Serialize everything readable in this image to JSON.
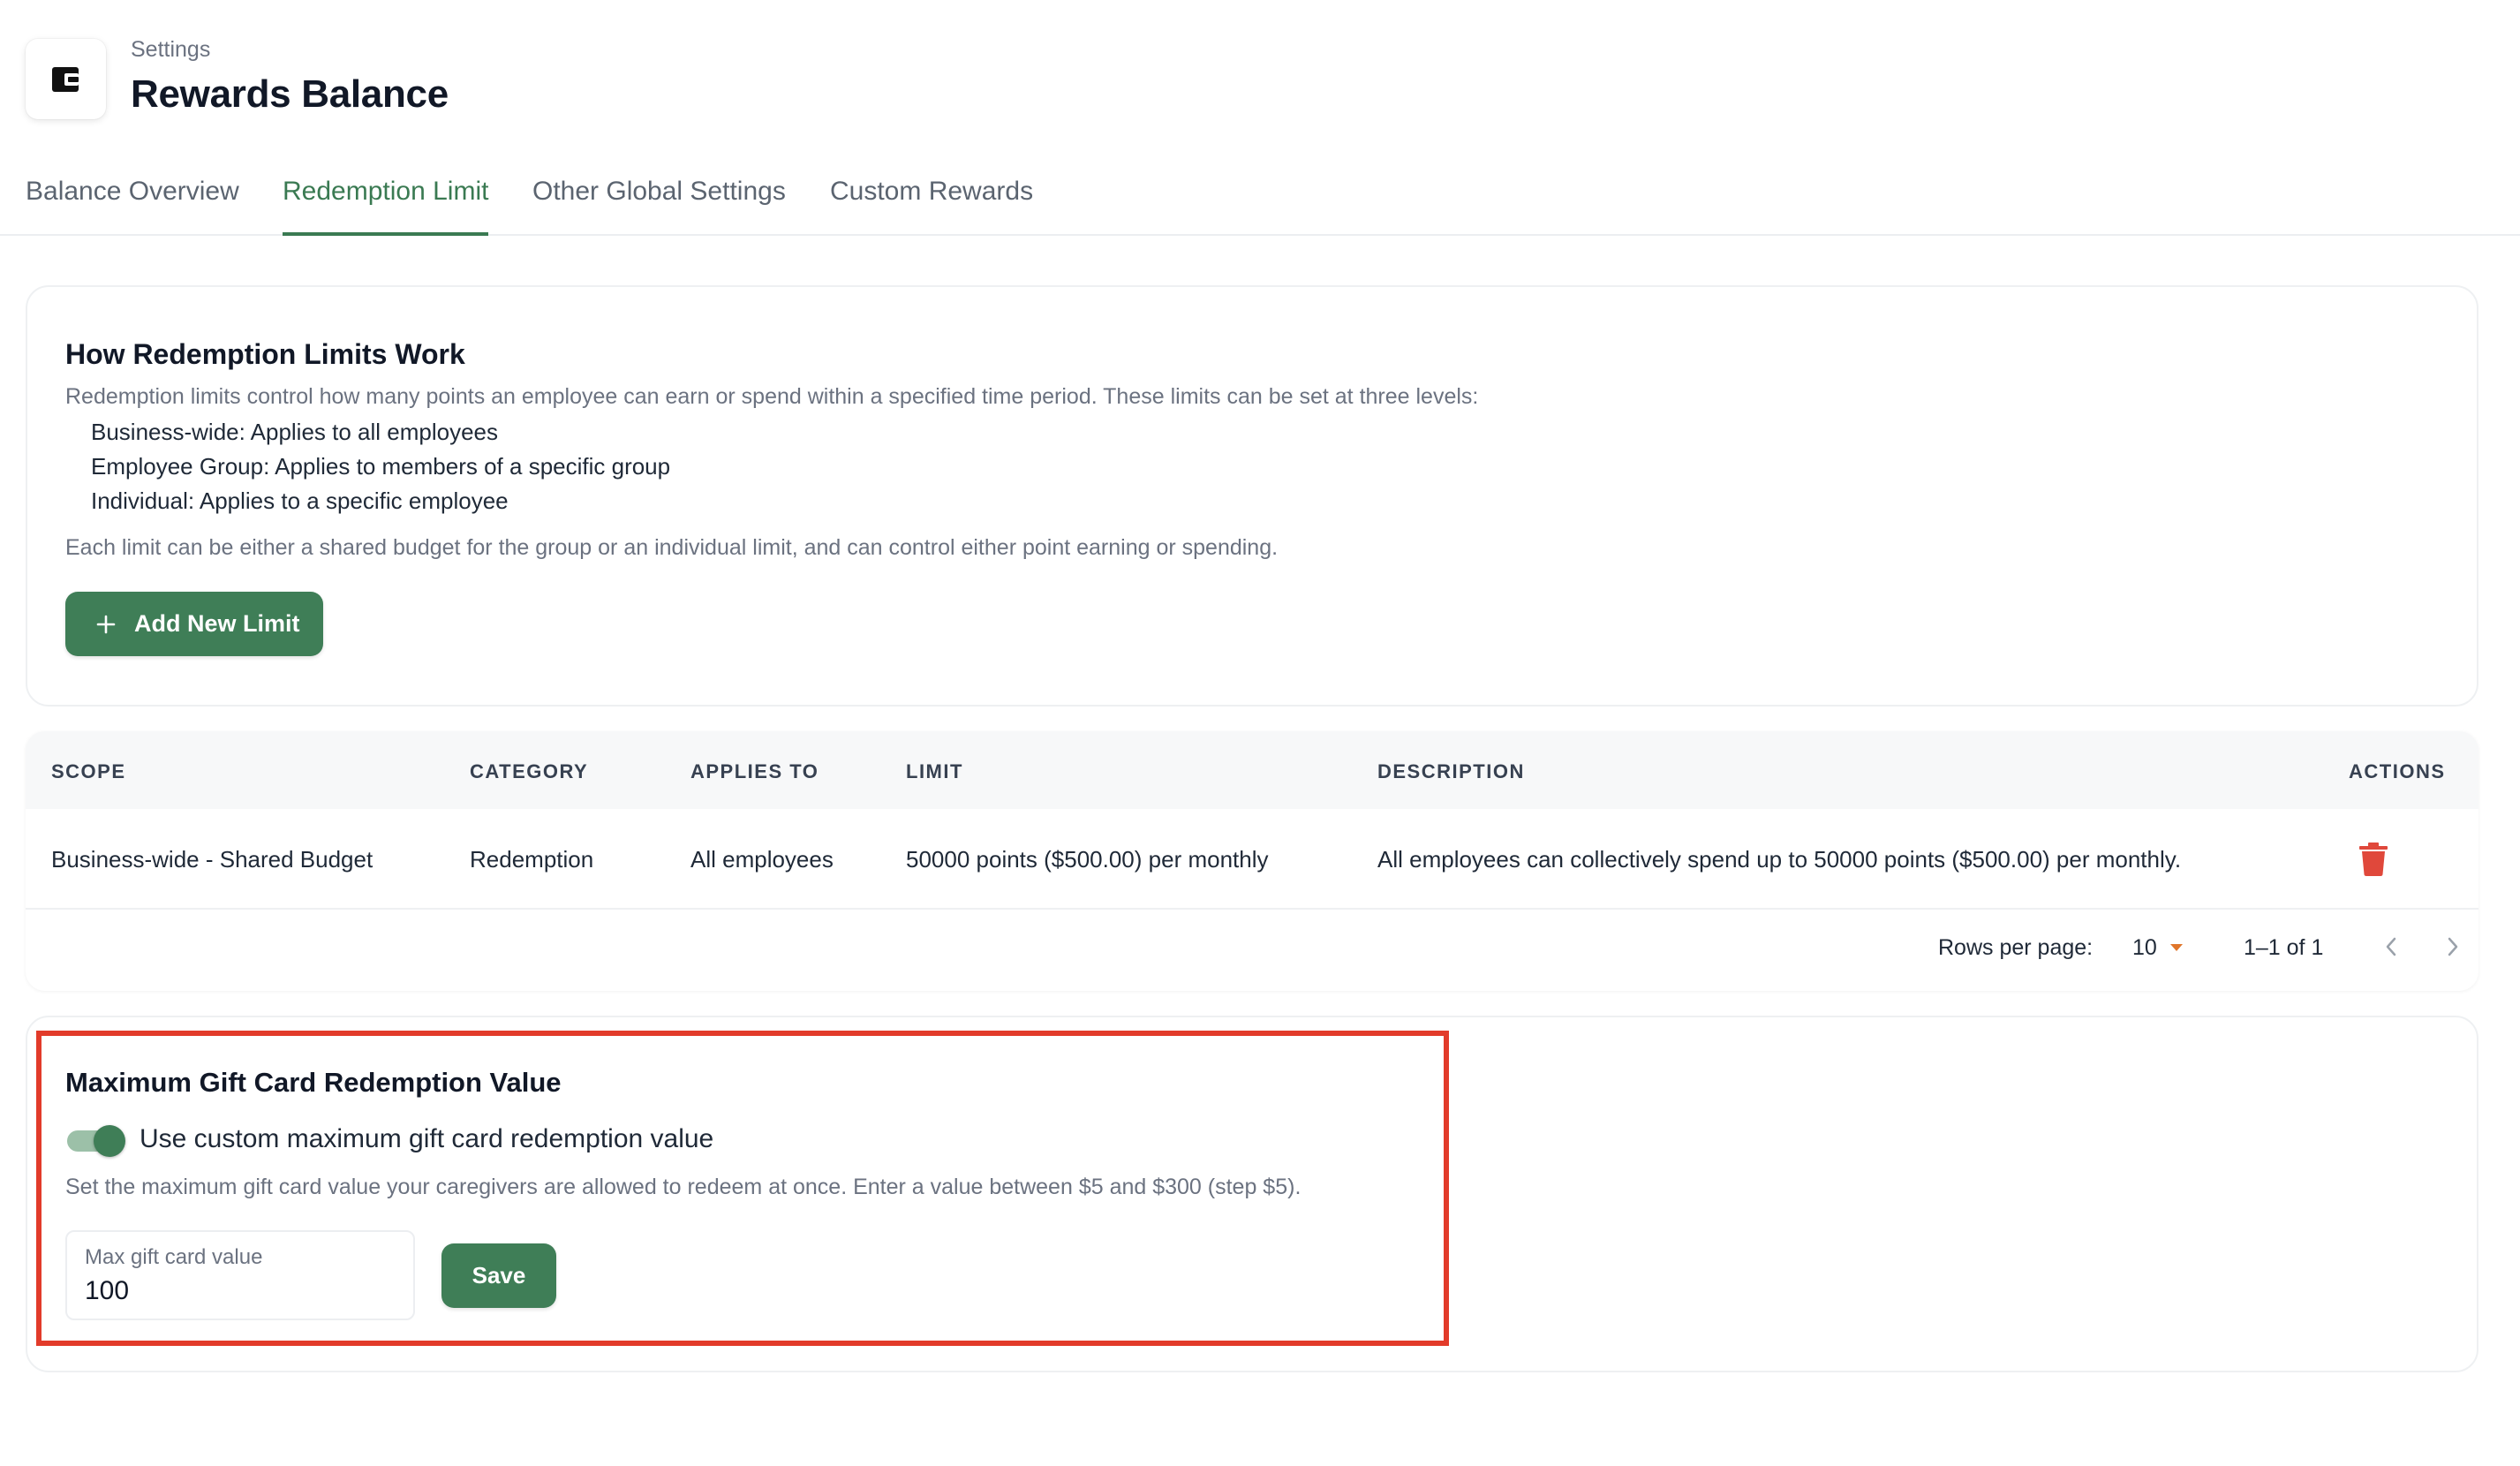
{
  "header": {
    "breadcrumb": "Settings",
    "title": "Rewards Balance",
    "icon": "wallet-icon"
  },
  "tabs": [
    {
      "label": "Balance Overview",
      "active": false
    },
    {
      "label": "Redemption Limit",
      "active": true
    },
    {
      "label": "Other Global Settings",
      "active": false
    },
    {
      "label": "Custom Rewards",
      "active": false
    }
  ],
  "info": {
    "title": "How Redemption Limits Work",
    "description": "Redemption limits control how many points an employee can earn or spend within a specified time period. These limits can be set at three levels:",
    "levels": [
      "Business-wide: Applies to all employees",
      "Employee Group: Applies to members of a specific group",
      "Individual: Applies to a specific employee"
    ],
    "note": "Each limit can be either a shared budget for the group or an individual limit, and can control either point earning or spending.",
    "add_button": "Add New Limit"
  },
  "table": {
    "columns": [
      "SCOPE",
      "CATEGORY",
      "APPLIES TO",
      "LIMIT",
      "DESCRIPTION",
      "ACTIONS"
    ],
    "rows": [
      {
        "scope": "Business-wide - Shared Budget",
        "category": "Redemption",
        "applies_to": "All employees",
        "limit": "50000 points ($500.00) per monthly",
        "description": "All employees can collectively spend up to 50000 points ($500.00) per monthly."
      }
    ],
    "pagination": {
      "rows_per_page_label": "Rows per page:",
      "rows_per_page": "10",
      "range": "1–1 of 1"
    }
  },
  "gift_card": {
    "title": "Maximum Gift Card Redemption Value",
    "toggle_label": "Use custom maximum gift card redemption value",
    "toggle_on": true,
    "description": "Set the maximum gift card value your caregivers are allowed to redeem at once. Enter a value between $5 and $300 (step $5).",
    "field_label": "Max gift card value",
    "field_value": "100",
    "save_button": "Save"
  },
  "colors": {
    "accent": "#3f7e57",
    "danger": "#e0483b",
    "highlight": "#e23b2a",
    "caret": "#e0762b"
  }
}
